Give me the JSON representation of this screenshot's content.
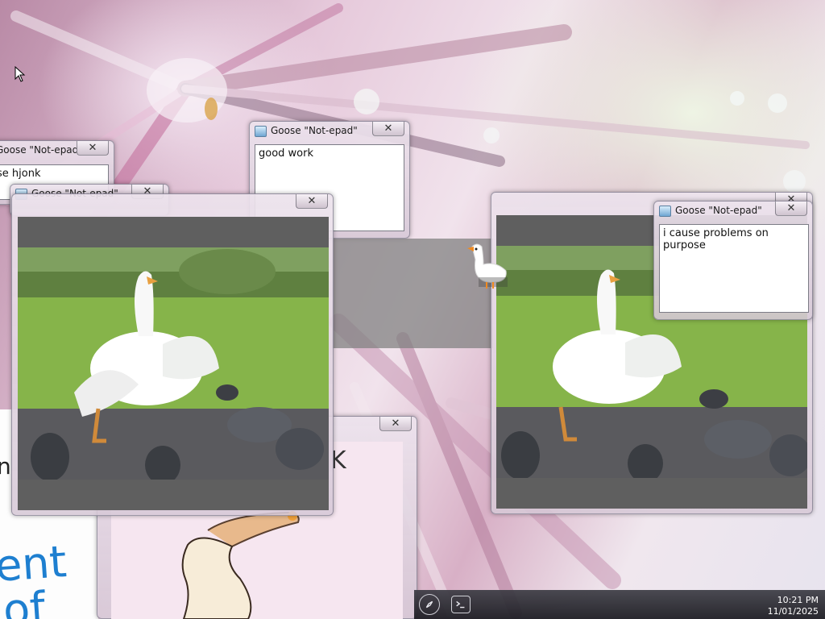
{
  "windows": {
    "notepad_partial": {
      "title": "Goose \"Not-epad\"",
      "close_label": "✕",
      "text": "se hjonk"
    },
    "notepad_partial_behind": {
      "title": "Goose \"Not-epad\"",
      "close_label": "✕"
    },
    "notepad_good_work": {
      "title": "Goose \"Not-epad\"",
      "close_label": "✕",
      "text": "good work"
    },
    "video_left": {
      "close_label": "✕"
    },
    "video_right": {
      "close_label": "✕"
    },
    "notepad_problems": {
      "title": "Goose \"Not-epad\"",
      "close_label": "✕",
      "text": "i cause problems on purpose"
    },
    "drawing_window": {
      "close_label": "✕"
    }
  },
  "drawing": {
    "left_text_line1": "ent",
    "left_text_line2": "of",
    "mid_text": "K"
  },
  "taskbar": {
    "clock_time": "10:21 PM",
    "clock_date": "11/01/2025"
  },
  "icons": [
    "cursor-icon",
    "notepad-icon",
    "close-icon",
    "compass-icon",
    "terminal-icon",
    "goose-icon"
  ]
}
